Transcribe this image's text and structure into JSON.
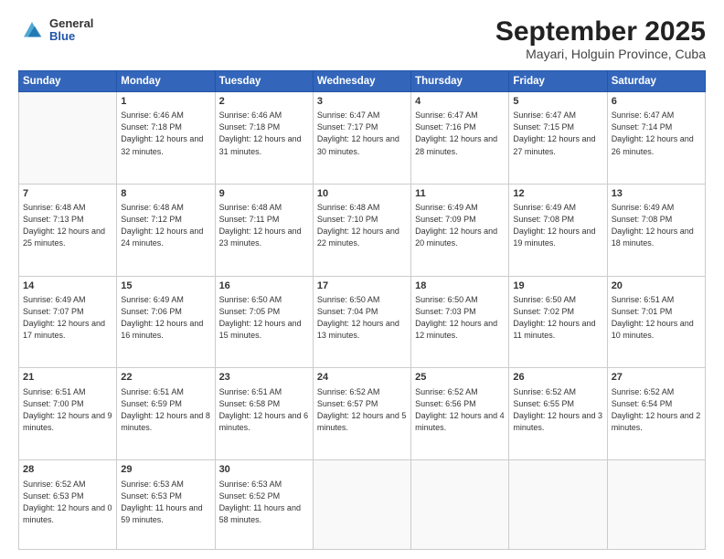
{
  "header": {
    "logo": {
      "general": "General",
      "blue": "Blue"
    },
    "title": "September 2025",
    "subtitle": "Mayari, Holguin Province, Cuba"
  },
  "days_of_week": [
    "Sunday",
    "Monday",
    "Tuesday",
    "Wednesday",
    "Thursday",
    "Friday",
    "Saturday"
  ],
  "weeks": [
    [
      {
        "day": "",
        "empty": true
      },
      {
        "day": "1",
        "sunrise": "Sunrise: 6:46 AM",
        "sunset": "Sunset: 7:18 PM",
        "daylight": "Daylight: 12 hours and 32 minutes."
      },
      {
        "day": "2",
        "sunrise": "Sunrise: 6:46 AM",
        "sunset": "Sunset: 7:18 PM",
        "daylight": "Daylight: 12 hours and 31 minutes."
      },
      {
        "day": "3",
        "sunrise": "Sunrise: 6:47 AM",
        "sunset": "Sunset: 7:17 PM",
        "daylight": "Daylight: 12 hours and 30 minutes."
      },
      {
        "day": "4",
        "sunrise": "Sunrise: 6:47 AM",
        "sunset": "Sunset: 7:16 PM",
        "daylight": "Daylight: 12 hours and 28 minutes."
      },
      {
        "day": "5",
        "sunrise": "Sunrise: 6:47 AM",
        "sunset": "Sunset: 7:15 PM",
        "daylight": "Daylight: 12 hours and 27 minutes."
      },
      {
        "day": "6",
        "sunrise": "Sunrise: 6:47 AM",
        "sunset": "Sunset: 7:14 PM",
        "daylight": "Daylight: 12 hours and 26 minutes."
      }
    ],
    [
      {
        "day": "7",
        "sunrise": "Sunrise: 6:48 AM",
        "sunset": "Sunset: 7:13 PM",
        "daylight": "Daylight: 12 hours and 25 minutes."
      },
      {
        "day": "8",
        "sunrise": "Sunrise: 6:48 AM",
        "sunset": "Sunset: 7:12 PM",
        "daylight": "Daylight: 12 hours and 24 minutes."
      },
      {
        "day": "9",
        "sunrise": "Sunrise: 6:48 AM",
        "sunset": "Sunset: 7:11 PM",
        "daylight": "Daylight: 12 hours and 23 minutes."
      },
      {
        "day": "10",
        "sunrise": "Sunrise: 6:48 AM",
        "sunset": "Sunset: 7:10 PM",
        "daylight": "Daylight: 12 hours and 22 minutes."
      },
      {
        "day": "11",
        "sunrise": "Sunrise: 6:49 AM",
        "sunset": "Sunset: 7:09 PM",
        "daylight": "Daylight: 12 hours and 20 minutes."
      },
      {
        "day": "12",
        "sunrise": "Sunrise: 6:49 AM",
        "sunset": "Sunset: 7:08 PM",
        "daylight": "Daylight: 12 hours and 19 minutes."
      },
      {
        "day": "13",
        "sunrise": "Sunrise: 6:49 AM",
        "sunset": "Sunset: 7:08 PM",
        "daylight": "Daylight: 12 hours and 18 minutes."
      }
    ],
    [
      {
        "day": "14",
        "sunrise": "Sunrise: 6:49 AM",
        "sunset": "Sunset: 7:07 PM",
        "daylight": "Daylight: 12 hours and 17 minutes."
      },
      {
        "day": "15",
        "sunrise": "Sunrise: 6:49 AM",
        "sunset": "Sunset: 7:06 PM",
        "daylight": "Daylight: 12 hours and 16 minutes."
      },
      {
        "day": "16",
        "sunrise": "Sunrise: 6:50 AM",
        "sunset": "Sunset: 7:05 PM",
        "daylight": "Daylight: 12 hours and 15 minutes."
      },
      {
        "day": "17",
        "sunrise": "Sunrise: 6:50 AM",
        "sunset": "Sunset: 7:04 PM",
        "daylight": "Daylight: 12 hours and 13 minutes."
      },
      {
        "day": "18",
        "sunrise": "Sunrise: 6:50 AM",
        "sunset": "Sunset: 7:03 PM",
        "daylight": "Daylight: 12 hours and 12 minutes."
      },
      {
        "day": "19",
        "sunrise": "Sunrise: 6:50 AM",
        "sunset": "Sunset: 7:02 PM",
        "daylight": "Daylight: 12 hours and 11 minutes."
      },
      {
        "day": "20",
        "sunrise": "Sunrise: 6:51 AM",
        "sunset": "Sunset: 7:01 PM",
        "daylight": "Daylight: 12 hours and 10 minutes."
      }
    ],
    [
      {
        "day": "21",
        "sunrise": "Sunrise: 6:51 AM",
        "sunset": "Sunset: 7:00 PM",
        "daylight": "Daylight: 12 hours and 9 minutes."
      },
      {
        "day": "22",
        "sunrise": "Sunrise: 6:51 AM",
        "sunset": "Sunset: 6:59 PM",
        "daylight": "Daylight: 12 hours and 8 minutes."
      },
      {
        "day": "23",
        "sunrise": "Sunrise: 6:51 AM",
        "sunset": "Sunset: 6:58 PM",
        "daylight": "Daylight: 12 hours and 6 minutes."
      },
      {
        "day": "24",
        "sunrise": "Sunrise: 6:52 AM",
        "sunset": "Sunset: 6:57 PM",
        "daylight": "Daylight: 12 hours and 5 minutes."
      },
      {
        "day": "25",
        "sunrise": "Sunrise: 6:52 AM",
        "sunset": "Sunset: 6:56 PM",
        "daylight": "Daylight: 12 hours and 4 minutes."
      },
      {
        "day": "26",
        "sunrise": "Sunrise: 6:52 AM",
        "sunset": "Sunset: 6:55 PM",
        "daylight": "Daylight: 12 hours and 3 minutes."
      },
      {
        "day": "27",
        "sunrise": "Sunrise: 6:52 AM",
        "sunset": "Sunset: 6:54 PM",
        "daylight": "Daylight: 12 hours and 2 minutes."
      }
    ],
    [
      {
        "day": "28",
        "sunrise": "Sunrise: 6:52 AM",
        "sunset": "Sunset: 6:53 PM",
        "daylight": "Daylight: 12 hours and 0 minutes."
      },
      {
        "day": "29",
        "sunrise": "Sunrise: 6:53 AM",
        "sunset": "Sunset: 6:53 PM",
        "daylight": "Daylight: 11 hours and 59 minutes."
      },
      {
        "day": "30",
        "sunrise": "Sunrise: 6:53 AM",
        "sunset": "Sunset: 6:52 PM",
        "daylight": "Daylight: 11 hours and 58 minutes."
      },
      {
        "day": "",
        "empty": true
      },
      {
        "day": "",
        "empty": true
      },
      {
        "day": "",
        "empty": true
      },
      {
        "day": "",
        "empty": true
      }
    ]
  ]
}
